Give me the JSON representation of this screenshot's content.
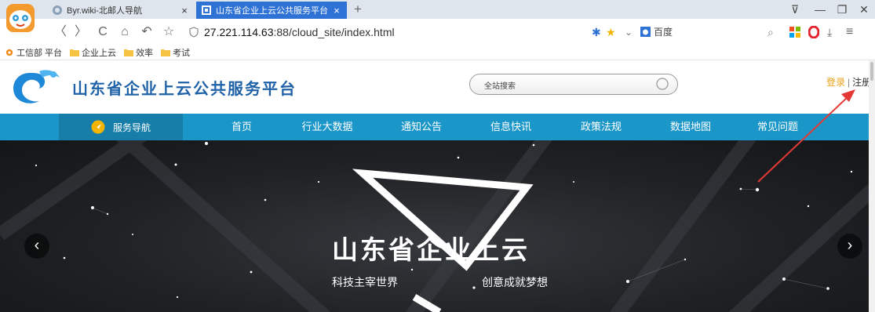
{
  "browser": {
    "tabs": [
      {
        "label": "Byr.wiki-北邮人导航",
        "active": false
      },
      {
        "label": "山东省企业上云公共服务平台",
        "active": true
      }
    ],
    "close_glyph": "×",
    "newtab_glyph": "+",
    "window_buttons": [
      "⊽",
      "—",
      "❐",
      "✕"
    ],
    "nav_glyphs": {
      "back": "〈",
      "forward": "〉",
      "reload": "C",
      "home": "⌂",
      "undo": "↶",
      "star": "☆"
    },
    "url_host": "27.221.114.63",
    "url_rest": ":88/cloud_site/index.html",
    "search_engine": "百度",
    "right_glyphs": {
      "ext": "✱",
      "fav": "★",
      "dropdown": "⌄",
      "search": "⌕",
      "download": "⤓",
      "menu": "≡"
    }
  },
  "bookmarks": [
    {
      "label": "工信部 平台",
      "icon": "orange-logo-icon"
    },
    {
      "label": "企业上云",
      "icon": "folder-icon"
    },
    {
      "label": "效率",
      "icon": "folder-icon"
    },
    {
      "label": "考试",
      "icon": "folder-icon"
    }
  ],
  "site": {
    "name": "山东省企业上云公共服务平台",
    "search_placeholder": "全站搜索",
    "login": "登录",
    "separator": "|",
    "register": "注册",
    "service_nav": "服务导航",
    "nav": [
      "首页",
      "行业大数据",
      "通知公告",
      "信息快讯",
      "政策法规",
      "数据地图",
      "常见问题"
    ]
  },
  "hero": {
    "title": "山东省企业上云",
    "subtitle_left": "科技主宰世界",
    "subtitle_right": "创意成就梦想",
    "prev": "‹",
    "next": "›"
  },
  "colors": {
    "brand_blue": "#1f62a8",
    "nav_bg": "#1b96c9",
    "service_nav_bg": "#167ea9",
    "login_orange": "#e8a11a",
    "tab_active": "#2f72d6",
    "annotation_red": "#e53935"
  }
}
